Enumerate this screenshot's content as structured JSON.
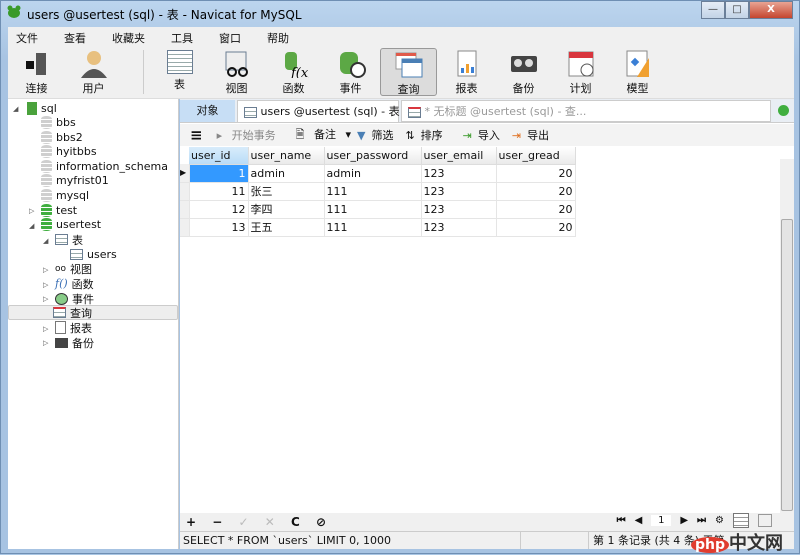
{
  "window": {
    "title": "users @usertest (sql) - 表 - Navicat for MySQL",
    "minimize": "—",
    "maximize": "□",
    "close": "X"
  },
  "menu": [
    "文件",
    "查看",
    "收藏夹",
    "工具",
    "窗口",
    "帮助"
  ],
  "toolbar": [
    {
      "label": "连接",
      "icon": "connection-icon"
    },
    {
      "label": "用户",
      "icon": "user-icon"
    },
    {
      "label": "表",
      "icon": "table-icon"
    },
    {
      "label": "视图",
      "icon": "view-icon"
    },
    {
      "label": "函数",
      "icon": "function-icon"
    },
    {
      "label": "事件",
      "icon": "event-icon"
    },
    {
      "label": "查询",
      "icon": "query-icon",
      "active": true
    },
    {
      "label": "报表",
      "icon": "report-icon"
    },
    {
      "label": "备份",
      "icon": "backup-icon"
    },
    {
      "label": "计划",
      "icon": "schedule-icon"
    },
    {
      "label": "模型",
      "icon": "model-icon"
    }
  ],
  "sidebar": {
    "connection": "sql",
    "databases": [
      "bbs",
      "bbs2",
      "hyitbbs",
      "information_schema",
      "myfrist01",
      "mysql",
      "test",
      "usertest"
    ],
    "usertest_children": {
      "tables": "表",
      "table_items": [
        "users"
      ],
      "views": "视图",
      "functions": "函数",
      "events": "事件",
      "queries": "查询",
      "reports": "报表",
      "backups": "备份"
    }
  },
  "tabs": {
    "objects": "对象",
    "table_tab": "users @usertest (sql) - 表",
    "query_tab": "* 无标题 @usertest (sql) - 查..."
  },
  "tools": {
    "menu": "≡",
    "begin_tx": "开始事务",
    "memo": "备注",
    "filter": "筛选",
    "sort": "排序",
    "import": "导入",
    "export": "导出"
  },
  "grid": {
    "columns": [
      "user_id",
      "user_name",
      "user_password",
      "user_email",
      "user_gread"
    ],
    "rows": [
      [
        "1",
        "admin",
        "admin",
        "123",
        "20"
      ],
      [
        "11",
        "张三",
        "111",
        "123",
        "20"
      ],
      [
        "12",
        "李四",
        "111",
        "123",
        "20"
      ],
      [
        "13",
        "王五",
        "111",
        "123",
        "20"
      ]
    ]
  },
  "bottom": {
    "add": "+",
    "remove": "−",
    "apply": "✓",
    "cancel": "✕",
    "refresh": "C",
    "stop": "⊘",
    "page": "1"
  },
  "status": {
    "query": "SELECT * FROM `users` LIMIT 0, 1000",
    "record": "第 1 条记录 (共 4 条) 于第"
  },
  "watermark": "php中文网",
  "colors": {
    "selection": "#3399ff",
    "accent": "#c7def5"
  }
}
